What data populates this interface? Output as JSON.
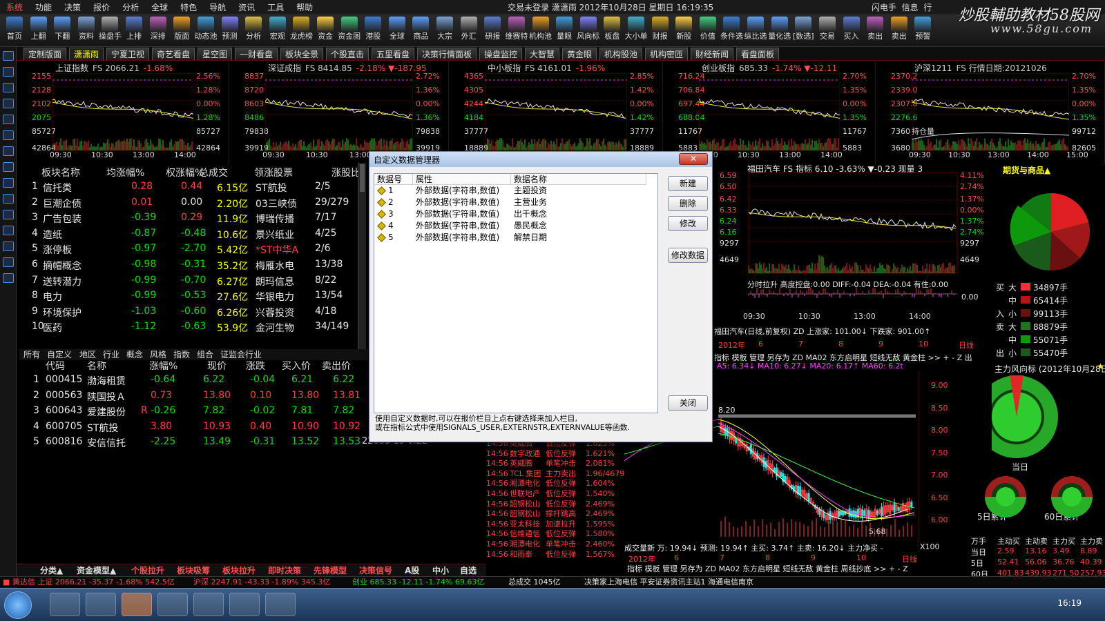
{
  "menu": [
    "系统",
    "功能",
    "决策",
    "报价",
    "分析",
    "全球",
    "特色",
    "导航",
    "资讯",
    "工具",
    "帮助"
  ],
  "status_title": "交易未登录   潇潇雨  2012年10月28日  星期日  16:19:35",
  "menu_right": [
    "闪电手",
    "信息",
    "行"
  ],
  "watermark": {
    "line1": "炒股輔助教材58股网",
    "line2": "www.58gu.com"
  },
  "toolbar": [
    "首页",
    "上翻",
    "下翻",
    "资料",
    "操盘手",
    "上排",
    "深排",
    "版面",
    "动态池",
    "预测",
    "分析",
    "宏观",
    "龙虎榜",
    "资金",
    "资金图",
    "港股",
    "全球",
    "商品",
    "大宗",
    "外汇",
    "研报",
    "维赛特",
    "机构池",
    "量眼",
    "风向标",
    "板盘",
    "大小单",
    "财报",
    "新股",
    "价值",
    "条件选",
    "纵比选",
    "量化选",
    "[数选]",
    "交易",
    "买入",
    "卖出",
    "卖出",
    "预警"
  ],
  "tabs": [
    "定制版面",
    "潇潇雨",
    "宁夏卫视",
    "奇艺看盘",
    "星空图",
    "一财看盘",
    "板块全景",
    "个股直击",
    "五里看盘",
    "决策行情面板",
    "操盘监控",
    "大智慧",
    "黄金眼",
    "机构股池",
    "机构密匝",
    "财经新闻",
    "看盘面板"
  ],
  "mini_charts": [
    {
      "name": "上证指数",
      "fs": "FS 2066.21",
      "pct": "-1.68%",
      "yl": [
        "2155",
        "2128",
        "2102",
        "2075",
        "85727",
        "42864"
      ],
      "yr": [
        "2.56%",
        "1.28%",
        "0.00%",
        "1.28%",
        "85727",
        "42864"
      ],
      "x": [
        "09:30",
        "10:30",
        "13:00",
        "14:00"
      ]
    },
    {
      "name": "深证成指",
      "fs": "FS 8414.85",
      "pct": "-2.18% ▼-187.95",
      "yl": [
        "8837",
        "8720",
        "8603",
        "8486",
        "79838",
        "39919"
      ],
      "yr": [
        "2.72%",
        "1.36%",
        "0.00%",
        "1.36%",
        "79838",
        "39919"
      ],
      "x": [
        "09:30",
        "10:30",
        "13:00",
        "14:00"
      ]
    },
    {
      "name": "中小板指",
      "fs": "FS 4161.01",
      "pct": "-1.96%",
      "yl": [
        "4365",
        "4305",
        "4244",
        "4184",
        "37777",
        "18889"
      ],
      "yr": [
        "2.85%",
        "1.42%",
        "0.00%",
        "1.42%",
        "37777",
        "18889"
      ],
      "x": [
        "09:30",
        "10:30",
        "13:00",
        "14:00"
      ]
    },
    {
      "name": "创业板指",
      "fs": "685.33",
      "pct": "-1.74% ▼-12.11",
      "yl": [
        "716.24",
        "706.84",
        "697.44",
        "688.04",
        "11767",
        "5883"
      ],
      "yr": [
        "2.70%",
        "1.35%",
        "0.00%",
        "1.35%",
        "11767",
        "5883"
      ],
      "x": [
        "09:30",
        "10:30",
        "13:00",
        "14:00"
      ]
    },
    {
      "name": "沪深1211",
      "fs": "FS 行情日期:20121026",
      "pct": "",
      "yl": [
        "2370.2",
        "2339.0",
        "2307.8",
        "2276.6",
        "7360",
        "3680"
      ],
      "yr": [
        "2.70%",
        "1.35%",
        "0.00%",
        "1.35%",
        "99712",
        "82605"
      ],
      "x": [
        "09:30",
        "10:30",
        "13:00",
        "14:00",
        "15:00"
      ],
      "extra": "持仓量"
    }
  ],
  "sector_table": {
    "headers": [
      "板块名称",
      "均涨幅%",
      "权涨幅%",
      "总成交",
      "领涨股票",
      "涨股比"
    ],
    "rows": [
      [
        "1",
        "信托类",
        "0.28",
        "0.44",
        "6.15亿",
        "ST航投",
        "2/5"
      ],
      [
        "2",
        "巨潮企债",
        "0.01",
        "0.00",
        "2.20亿",
        "03三峡债",
        "29/279"
      ],
      [
        "3",
        "广告包装",
        "-0.39",
        "0.29",
        "11.9亿",
        "博瑞传播",
        "7/17"
      ],
      [
        "4",
        "造纸",
        "-0.87",
        "-0.48",
        "10.6亿",
        "景兴纸业",
        "4/25"
      ],
      [
        "5",
        "涨停板",
        "-0.97",
        "-2.70",
        "5.42亿",
        "*ST中华A",
        "2/6"
      ],
      [
        "6",
        "摘帽概念",
        "-0.98",
        "-0.31",
        "35.2亿",
        "梅雁水电",
        "13/38"
      ],
      [
        "7",
        "送转潜力",
        "-0.99",
        "-0.70",
        "6.27亿",
        "朗玛信息",
        "8/22"
      ],
      [
        "8",
        "电力",
        "-0.99",
        "-0.53",
        "27.6亿",
        "华银电力",
        "13/54"
      ],
      [
        "9",
        "环境保护",
        "-1.03",
        "-0.60",
        "6.26亿",
        "兴蓉投资",
        "4/18"
      ],
      [
        "10",
        "医药",
        "-1.12",
        "-0.63",
        "53.9亿",
        "金河生物",
        "34/149"
      ]
    ]
  },
  "sub_tabs": [
    "所有",
    "自定义",
    "地区",
    "行业",
    "概念",
    "风格",
    "指数",
    "组合",
    "证监会行业"
  ],
  "stock_table": {
    "headers": [
      "代码",
      "名称",
      "涨幅%",
      "现价",
      "涨跌",
      "买入价",
      "卖出价"
    ],
    "rows": [
      [
        "1",
        "000415",
        "渤海租赁",
        "",
        "-0.64",
        "6.22",
        "-0.04",
        "6.21",
        "6.22"
      ],
      [
        "2",
        "000563",
        "陕国投Ａ",
        "",
        "0.73",
        "13.80",
        "0.10",
        "13.80",
        "13.81"
      ],
      [
        "3",
        "600643",
        "爱建股份",
        "R",
        "-0.26",
        "7.82",
        "-0.02",
        "7.81",
        "7.82"
      ],
      [
        "4",
        "600705",
        "ST航投",
        "",
        "3.80",
        "10.93",
        "0.40",
        "10.90",
        "10.92"
      ],
      [
        "5",
        "600816",
        "安信信托",
        "",
        "-2.25",
        "13.49",
        "-0.31",
        "13.52",
        "13.53"
      ]
    ],
    "partial": "22655    15    0.22"
  },
  "dialog": {
    "title": "自定义数据管理器",
    "close": "✕",
    "columns": [
      "数据号",
      "属性",
      "数据名称"
    ],
    "rows": [
      [
        "1",
        "外部数据(字符串,数值)",
        "主题投资"
      ],
      [
        "2",
        "外部数据(字符串,数值)",
        "主营业务"
      ],
      [
        "3",
        "外部数据(字符串,数值)",
        "出千概念"
      ],
      [
        "4",
        "外部数据(字符串,数值)",
        "愚民概念"
      ],
      [
        "5",
        "外部数据(字符串,数值)",
        "解禁日期"
      ]
    ],
    "buttons": {
      "new": "新建",
      "delete": "删除",
      "modify": "修改",
      "modify_data": "修改数据",
      "close": "关闭"
    },
    "note1": "使用自定义数据时,可以在报价栏目上点右键选择来加入栏目,",
    "note2": "或在指标公式中使用SIGNALS_USER,EXTERNSTR,EXTERNVALUE等函数."
  },
  "right_top": {
    "title": "福田汽车  FS 指标 6.10 -3.63% ▼-0.23 现量 3",
    "yl": [
      "6.59",
      "6.50",
      "6.42",
      "6.33",
      "6.24",
      "6.16",
      "9297",
      "4649"
    ],
    "yr": [
      "4.11%",
      "2.74%",
      "1.37%",
      "0.00%",
      "1.37%",
      "2.74%",
      "9297",
      "4649"
    ],
    "ind": "分时拉升 高度控盘:0.00 DIFF:-0.04 DEA:-0.04 有住:0.00",
    "ind_zero": "0.00",
    "x": [
      "09:30",
      "10:30",
      "13:00",
      "14:00"
    ],
    "kline_head": "福田汽车(日线,前复权) ZD  上涨家: 101.00↓  下跌家: 901.00↑",
    "kx": [
      "2012年",
      "6",
      "7",
      "8",
      "9",
      "10",
      "日线"
    ],
    "ktabs": "指标 模板 管理 另存为 ZD MA02 东方启明星 短线无敌 黄金柱 >> + - Z 出",
    "ma": "A5: 6.34↓  MA10: 6.27↓  MA20: 6.17↑  MA60: 6.2t",
    "kright": [
      "9.00",
      "8.50",
      "8.00",
      "7.50",
      "7.00",
      "6.50",
      "6.00"
    ],
    "kmark": "8.20",
    "klow": "5.68",
    "vol": "成交量新 万: 19.94↓  预测: 19.94↑  主买: 3.74↑  主卖: 16.20↓  主力净买 -",
    "kbot_x": [
      "2012年",
      "6",
      "7",
      "8",
      "9",
      "10",
      "日线"
    ],
    "kbot_tabs": "指标 模板 管理 另存为 ZD MA02 东方启明星 短线无敌 黄金柱 周线抄底 >> + - Z",
    "x100": "X100"
  },
  "right_panel": {
    "title": "期货与商品▲",
    "flows": [
      [
        "买",
        "大",
        "34897手"
      ],
      [
        "",
        "中",
        "65414手"
      ],
      [
        "入",
        "小",
        "99113手"
      ],
      [
        "卖",
        "大",
        "88879手"
      ],
      [
        "",
        "中",
        "55071手"
      ],
      [
        "出",
        "小",
        "55470手"
      ]
    ],
    "fx_title": "主力风向标 (2012年10月28日)",
    "fx_today": "当日",
    "fx_5": "5日累计",
    "fx_60": "60日累计",
    "tbl_head": [
      "万手",
      "主动买",
      "主动卖",
      "主力买",
      "主力卖"
    ],
    "tbl": [
      [
        "当日",
        "2.59",
        "13.16",
        "3.49",
        "8.89"
      ],
      [
        "5日",
        "52.41",
        "56.06",
        "36.76",
        "40.39"
      ],
      [
        "60日",
        "401.83",
        "439.93",
        "271.50",
        "257.93"
      ]
    ]
  },
  "deals": [
    [
      "14:56",
      "英威腾",
      "低位反弹",
      "1.625%"
    ],
    [
      "14:56",
      "数字政通",
      "低位反弹",
      "1.621%"
    ],
    [
      "14:56",
      "英威腾",
      "单笔冲击",
      "2.081%"
    ],
    [
      "14:56",
      "TCL 集团",
      "主力卖出",
      "1.96/4679"
    ],
    [
      "14:56",
      "湘潭电化",
      "低位反弹",
      "1.604%"
    ],
    [
      "14:56",
      "世联地产",
      "低位反弹",
      "1.540%"
    ],
    [
      "14:56",
      "韶钢松山",
      "低位反弹",
      "2.469%"
    ],
    [
      "14:56",
      "韶钢松山",
      "撑杆跳高",
      "2.469%"
    ],
    [
      "14:56",
      "亚太科技",
      "加速拉升",
      "1.595%"
    ],
    [
      "14:56",
      "信维通信",
      "低位反弹",
      "1.580%"
    ],
    [
      "14:56",
      "湘潭电化",
      "单笔冲击",
      "2.460%"
    ],
    [
      "14:56",
      "和而泰",
      "低位反弹",
      "1.567%"
    ]
  ],
  "bottom_tabs": [
    "分类▲",
    "资金模型▲",
    "个股拉升",
    "板块吸筹",
    "板块拉升",
    "即时决策",
    "先锋模型",
    "决策信号",
    "A股",
    "中小",
    "自选"
  ],
  "statusline": {
    "a": "■ 黄达信  上证 2066.21 -35.37 -1.68% 542.5亿",
    "b": "沪深 2247.91 -43.33 -1.89% 345.3亿",
    "c": "创业 685.33 -12.11 -1.74% 69.63亿",
    "d": "总成交  1045亿",
    "e": "决策家上海电信  平安证券资讯主站1  海通电信南京"
  },
  "clock": "16:19"
}
